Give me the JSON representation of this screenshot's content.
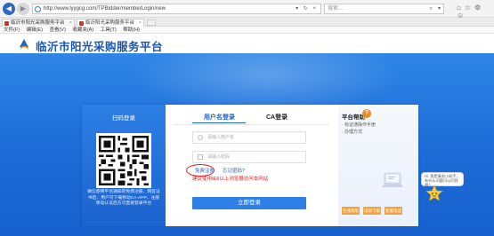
{
  "browser": {
    "address": "http://www.lyygcg.com/TPBidder/memberLogin/new",
    "search_placeholder": "搜索...",
    "tabs": [
      {
        "label": "临沂市阳光采购服务平台",
        "close": "×"
      },
      {
        "label": "临沂阳光采购服务平台",
        "close": "×"
      }
    ],
    "menu": [
      "文件(F)",
      "编辑(E)",
      "查看(V)",
      "收藏夹(A)",
      "工具(T)",
      "帮助(H)"
    ]
  },
  "site": {
    "title": "临沂市阳光采购服务平台"
  },
  "login": {
    "qr_title": "扫码登录",
    "qr_text": "微信使用平台通知的免费注册、网签证书后，用户可下载移动CA-APP，注册移动认证后方可直接登录平台",
    "tab_user": "用户名登录",
    "tab_ca": "CA登录",
    "username_placeholder": "请输入用户名",
    "password_placeholder": "请输入密码",
    "register": "免费注册",
    "forgot": "忘记密码?",
    "notice": "建议使用IE8以上浏览器访问本网站",
    "submit": "立即登录"
  },
  "help": {
    "title": "平台帮助",
    "items": [
      "· 标证通操作手册",
      "· 办理方式"
    ],
    "buttons": [
      "在线帮助",
      "培训下载",
      "客服电话"
    ]
  },
  "assistant": {
    "bubble": "Hi, 我是服务小助手，有什么问题可以问我哦！"
  },
  "colors": {
    "brand_blue": "#1654b8",
    "banner_blue": "#1f6fd9",
    "button_blue": "#2f80e6",
    "alert_red": "#e02222",
    "help_orange": "#f08a1d"
  }
}
